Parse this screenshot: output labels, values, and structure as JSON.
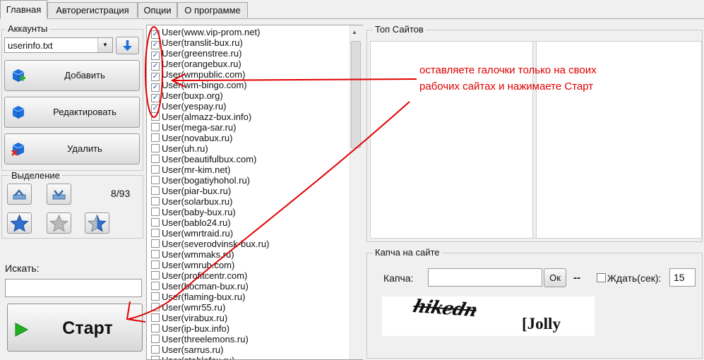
{
  "tabs": [
    {
      "label": "Главная"
    },
    {
      "label": "Авторегистрация"
    },
    {
      "label": "Опции"
    },
    {
      "label": "О программе"
    }
  ],
  "accounts": {
    "group_label": "Аккаунты",
    "file": "userinfo.txt",
    "add_label": "Добавить",
    "edit_label": "Редактировать",
    "delete_label": "Удалить"
  },
  "selection": {
    "group_label": "Выделение",
    "count": "8/93"
  },
  "search": {
    "label": "Искать:",
    "value": ""
  },
  "start_label": "Старт",
  "sites": [
    {
      "label": "User(www.vip-prom.net)",
      "checked": true
    },
    {
      "label": "User(translit-bux.ru)",
      "checked": true
    },
    {
      "label": "User(greenstree.ru)",
      "checked": true
    },
    {
      "label": "User(orangebux.ru)",
      "checked": true
    },
    {
      "label": "User(wmpublic.com)",
      "checked": true
    },
    {
      "label": "User(wm-bingo.com)",
      "checked": true
    },
    {
      "label": "User(buxp.org)",
      "checked": true
    },
    {
      "label": "User(yespay.ru)",
      "checked": true
    },
    {
      "label": "User(almazz-bux.info)",
      "checked": false
    },
    {
      "label": "User(mega-sar.ru)",
      "checked": false
    },
    {
      "label": "User(novabux.ru)",
      "checked": false
    },
    {
      "label": "User(uh.ru)",
      "checked": false
    },
    {
      "label": "User(beautifulbux.com)",
      "checked": false
    },
    {
      "label": "User(mr-kim.net)",
      "checked": false
    },
    {
      "label": "User(bogatiyhohol.ru)",
      "checked": false
    },
    {
      "label": "User(piar-bux.ru)",
      "checked": false
    },
    {
      "label": "User(solarbux.ru)",
      "checked": false
    },
    {
      "label": "User(baby-bux.ru)",
      "checked": false
    },
    {
      "label": "User(bablo24.ru)",
      "checked": false
    },
    {
      "label": "User(wmrtraid.ru)",
      "checked": false
    },
    {
      "label": "User(severodvinsk-bux.ru)",
      "checked": false
    },
    {
      "label": "User(wmmaks.ru)",
      "checked": false
    },
    {
      "label": "User(wmrub.com)",
      "checked": false
    },
    {
      "label": "User(profitcentr.com)",
      "checked": false
    },
    {
      "label": "User(bocman-bux.ru)",
      "checked": false
    },
    {
      "label": "User(flaming-bux.ru)",
      "checked": false
    },
    {
      "label": "User(wmr55.ru)",
      "checked": false
    },
    {
      "label": "User(virabux.ru)",
      "checked": false
    },
    {
      "label": "User(ip-bux.info)",
      "checked": false
    },
    {
      "label": "User(threelemons.ru)",
      "checked": false
    },
    {
      "label": "User(sarrus.ru)",
      "checked": false
    },
    {
      "label": "User(stablefox.ru)",
      "checked": false
    }
  ],
  "top_sites": {
    "group_label": "Топ Сайтов"
  },
  "captcha": {
    "group_label": "Капча на сайте",
    "label": "Капча:",
    "value": "",
    "ok_label": "Ок",
    "dashes": "--",
    "wait_label": "Ждать(сек):",
    "wait_checked": false,
    "wait_value": "15",
    "image_word1": "hikedn",
    "image_word2": "[Jolly"
  },
  "annotation": {
    "line1": "оставляете галочки только на своих",
    "line2": "рабочих сайтах и нажимаете Старт"
  },
  "colors": {
    "annotation": "#e00000",
    "checkmark": "#1f4fb3",
    "icon_blue": "#1e6fd9",
    "start_green": "#22b022"
  }
}
